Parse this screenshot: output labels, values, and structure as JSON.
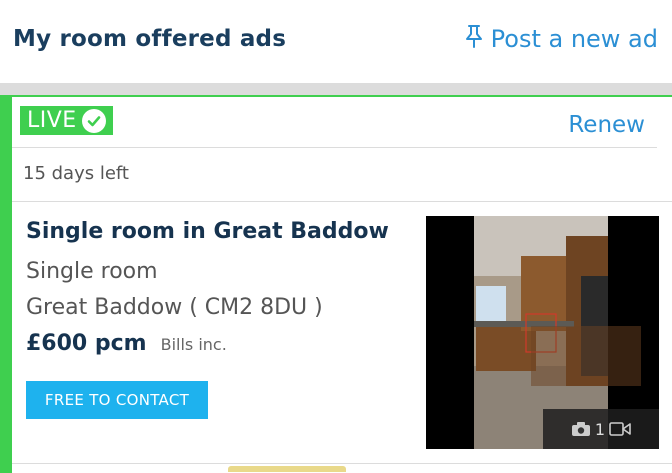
{
  "header": {
    "title": "My room offered ads",
    "post_label": "Post a new ad"
  },
  "ad": {
    "status": "LIVE",
    "renew_label": "Renew",
    "days_left": "15 days left",
    "title": "Single room in Great Baddow",
    "room_type": "Single room",
    "location": "Great Baddow ( CM2 8DU )",
    "price": "£600 pcm",
    "bills": "Bills inc.",
    "contact_label": "FREE TO CONTACT",
    "photo_count": "1"
  },
  "colors": {
    "live_green": "#3fcf4f",
    "link_blue": "#2b8fd4",
    "button_blue": "#1eb2ee",
    "title_navy": "#16334f"
  },
  "icons": [
    "pin-icon",
    "check-circle-icon",
    "camera-icon",
    "video-icon"
  ]
}
